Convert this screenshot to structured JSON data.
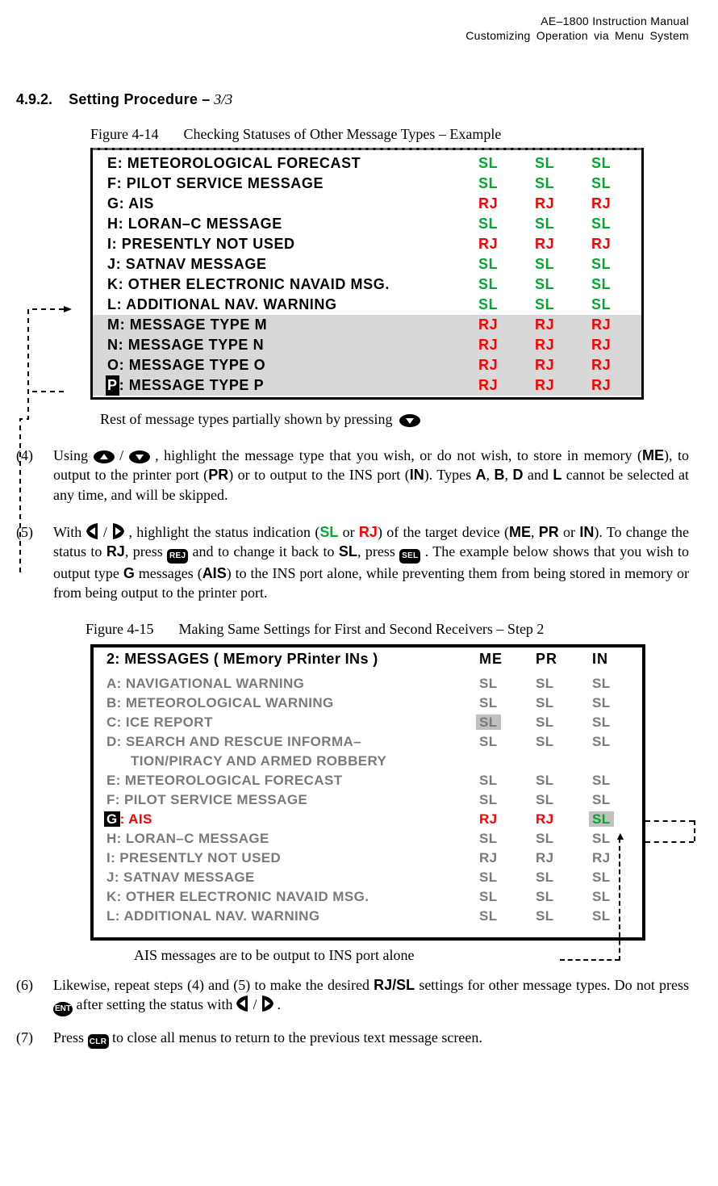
{
  "header": {
    "line1": "AE–1800 Instruction Manual",
    "line2": "Customizing Operation via Menu System"
  },
  "section": {
    "number": "4.9.2.",
    "title": "Setting Procedure",
    "page_frac": "3/3"
  },
  "figure14": {
    "caption_prefix": "Figure 4-14",
    "caption_text": "Checking Statuses of Other Message Types – Example",
    "rows": [
      {
        "letter": "E",
        "sep": ":",
        "name": "METEOROLOGICAL FORECAST",
        "c1": "SL",
        "c2": "SL",
        "c3": "SL",
        "cls": "green",
        "hi": false
      },
      {
        "letter": "F",
        "sep": ":",
        "name": "PILOT SERVICE MESSAGE",
        "c1": "SL",
        "c2": "SL",
        "c3": "SL",
        "cls": "green",
        "hi": false
      },
      {
        "letter": "G",
        "sep": ":",
        "name": "AIS",
        "c1": "RJ",
        "c2": "RJ",
        "c3": "RJ",
        "cls": "red",
        "hi": false
      },
      {
        "letter": "H",
        "sep": ":",
        "name": "LORAN–C MESSAGE",
        "c1": "SL",
        "c2": "SL",
        "c3": "SL",
        "cls": "green",
        "hi": false
      },
      {
        "letter": " I",
        "sep": ":",
        "name": "PRESENTLY NOT USED",
        "c1": "RJ",
        "c2": "RJ",
        "c3": "RJ",
        "cls": "red",
        "hi": false
      },
      {
        "letter": "J",
        "sep": ":",
        "name": "SATNAV MESSAGE",
        "c1": "SL",
        "c2": "SL",
        "c3": "SL",
        "cls": "green",
        "hi": false
      },
      {
        "letter": "K",
        "sep": ":",
        "name": "OTHER ELECTRONIC NAVAID MSG.",
        "c1": "SL",
        "c2": "SL",
        "c3": "SL",
        "cls": "green",
        "hi": false
      },
      {
        "letter": "L",
        "sep": ":",
        "name": "ADDITIONAL NAV. WARNING",
        "c1": "SL",
        "c2": "SL",
        "c3": "SL",
        "cls": "green",
        "hi": false
      },
      {
        "letter": "M",
        "sep": ":",
        "name": "MESSAGE TYPE M",
        "c1": "RJ",
        "c2": "RJ",
        "c3": "RJ",
        "cls": "red",
        "hi": true
      },
      {
        "letter": "N",
        "sep": ":",
        "name": "MESSAGE TYPE N",
        "c1": "RJ",
        "c2": "RJ",
        "c3": "RJ",
        "cls": "red",
        "hi": true
      },
      {
        "letter": "O",
        "sep": ":",
        "name": "MESSAGE TYPE O",
        "c1": "RJ",
        "c2": "RJ",
        "c3": "RJ",
        "cls": "red",
        "hi": true
      },
      {
        "letter": "P",
        "sep": ":",
        "name": "MESSAGE TYPE P",
        "c1": "RJ",
        "c2": "RJ",
        "c3": "RJ",
        "cls": "red",
        "hi": true,
        "hichar": true
      }
    ]
  },
  "rest_note": "Rest of message types partially shown by pressing",
  "step4": {
    "num": "(4)",
    "pre": "Using ",
    "mid": ", highlight the message type that you wish, or do not wish, to store in memory (",
    "ME": "ME",
    "mid2": "), to output to the printer port (",
    "PR": "PR",
    "mid3": ") or to output to the INS port (",
    "IN": "IN",
    "mid4": "). Types ",
    "A": "A",
    "mid5": ", ",
    "B": "B",
    "mid6": ", ",
    "D": "D",
    "mid7": " and ",
    "L": "L",
    "tail": " cannot be selected at any time, and will be skipped."
  },
  "step5": {
    "num": "(5)",
    "pre": "With ",
    "mid1": ", highlight the status indication (",
    "SL": "SL",
    "or": " or ",
    "RJ": "RJ",
    "mid2": ") of the target device (",
    "ME": "ME",
    "c1": ", ",
    "PR": "PR",
    "c2": " or ",
    "IN": "IN",
    "mid3": "). To change the status to ",
    "RJ2": "RJ",
    "mid3b": ", press ",
    "REJ": "REJ",
    "mid4": "  and to change it back to ",
    "SL2": "SL",
    "mid4b": ", press ",
    "SEL": "SEL",
    "mid5": " . The example below shows that you wish to output type ",
    "G": "G",
    "mid6": " messages (",
    "AIS": "AIS",
    "tail": ") to the INS port alone, while preventing them from being stored in memory or from being output to the printer port."
  },
  "figure15": {
    "caption_prefix": "Figure 4-15",
    "caption_text": "Making Same Settings for First and Second Receivers – Step 2",
    "header": {
      "title": "2: MESSAGES ( MEmory   PRinter   INs )",
      "c1": "ME",
      "c2": "PR",
      "c3": "IN"
    },
    "rows": [
      {
        "letter": "A",
        "sep": ":",
        "name": "NAVIGATIONAL WARNING",
        "c1": "SL",
        "c2": "SL",
        "c3": "SL"
      },
      {
        "letter": "B",
        "sep": ":",
        "name": "METEOROLOGICAL WARNING",
        "c1": "SL",
        "c2": "SL",
        "c3": "SL"
      },
      {
        "letter": "C",
        "sep": ":",
        "name": "ICE REPORT",
        "c1": "SL",
        "c2": "SL",
        "c3": "SL",
        "hi_c1": true
      },
      {
        "letter": "D",
        "sep": ":",
        "name": "SEARCH AND RESCUE INFORMA–",
        "name2": "TION/PIRACY AND ARMED ROBBERY",
        "c1": "SL",
        "c2": "SL",
        "c3": "SL"
      },
      {
        "letter": "E",
        "sep": ":",
        "name": "METEOROLOGICAL FORECAST",
        "c1": "SL",
        "c2": "SL",
        "c3": "SL"
      },
      {
        "letter": "F",
        "sep": ":",
        "name": "PILOT SERVICE MESSAGE",
        "c1": "SL",
        "c2": "SL",
        "c3": "SL"
      },
      {
        "letter": "G",
        "sep": ":",
        "name": "AIS",
        "c1": "RJ",
        "c2": "RJ",
        "c3": "SL",
        "sel": true
      },
      {
        "letter": "H",
        "sep": ":",
        "name": "LORAN–C MESSAGE",
        "c1": "SL",
        "c2": "SL",
        "c3": "SL"
      },
      {
        "letter": " I",
        "sep": ":",
        "name": "PRESENTLY NOT USED",
        "c1": "RJ",
        "c2": "RJ",
        "c3": "RJ"
      },
      {
        "letter": "J",
        "sep": ":",
        "name": "SATNAV MESSAGE",
        "c1": "SL",
        "c2": "SL",
        "c3": "SL"
      },
      {
        "letter": "K",
        "sep": ":",
        "name": "OTHER ELECTRONIC NAVAID MSG.",
        "c1": "SL",
        "c2": "SL",
        "c3": "SL"
      },
      {
        "letter": "L",
        "sep": ":",
        "name": "ADDITIONAL NAV. WARNING",
        "c1": "SL",
        "c2": "SL",
        "c3": "SL"
      }
    ]
  },
  "annotation15": "AIS messages are to be output to INS port alone",
  "step6": {
    "num": "(6)",
    "pre": "Likewise, repeat steps (4) and (5) to make the desired ",
    "RJSL": "RJ/SL",
    "mid": " settings for other message types. Do not press ",
    "ENT": "ENT",
    "mid2": "  after setting the status with ",
    "tail": "."
  },
  "step7": {
    "num": "(7)",
    "pre": "Press ",
    "CLR": "CLR",
    "tail": " to close all menus to return to the previous text message screen."
  },
  "icons": {
    "up": "▲",
    "down": "▼",
    "left": "◀",
    "right": "▶"
  }
}
